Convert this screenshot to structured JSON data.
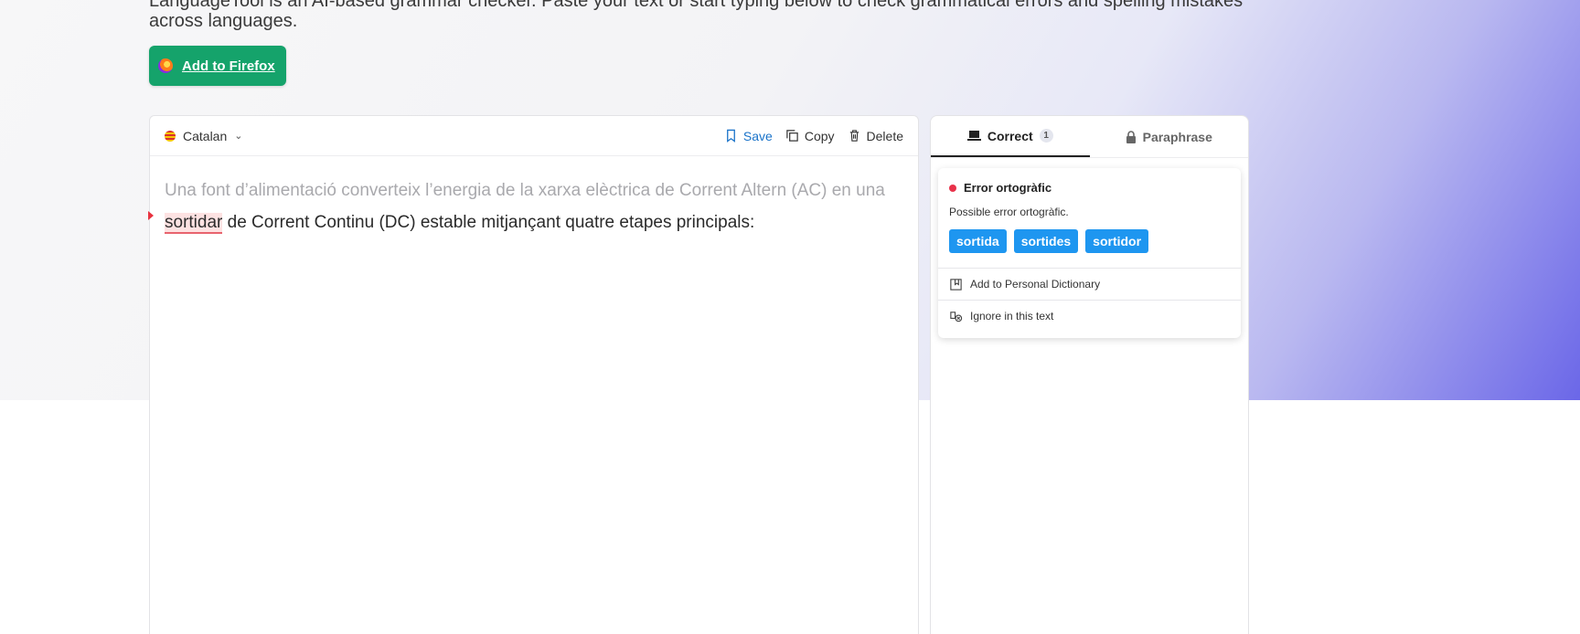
{
  "intro": {
    "line1": "LanguageTool is an AI-based grammar checker. Paste your text or start typing below to check grammatical errors and spelling mistakes",
    "line2": "across languages."
  },
  "firefox_button": {
    "label": "Add to Firefox"
  },
  "editor": {
    "language": "Catalan",
    "save_label": "Save",
    "copy_label": "Copy",
    "delete_label": "Delete",
    "ghost_text": "Una font d’alimentació converteix l’energia de la xarxa elèctrica de Corrent Altern (AC) en una",
    "error_word": "sortidar",
    "typed_rest": " de Corrent Continu (DC) estable mitjançant quatre etapes principals:"
  },
  "side": {
    "tabs": [
      {
        "label": "Correct",
        "count": "1"
      },
      {
        "label": "Paraphrase"
      }
    ],
    "card": {
      "title": "Error ortogràfic",
      "message": "Possible error ortogràfic.",
      "suggestions": [
        "sortida",
        "sortides",
        "sortidor"
      ],
      "add_dictionary": "Add to Personal Dictionary",
      "ignore": "Ignore in this text"
    }
  },
  "colors": {
    "accent_green": "#15a36b",
    "suggestion_blue": "#1e96f0",
    "error_red": "#e8324a"
  }
}
